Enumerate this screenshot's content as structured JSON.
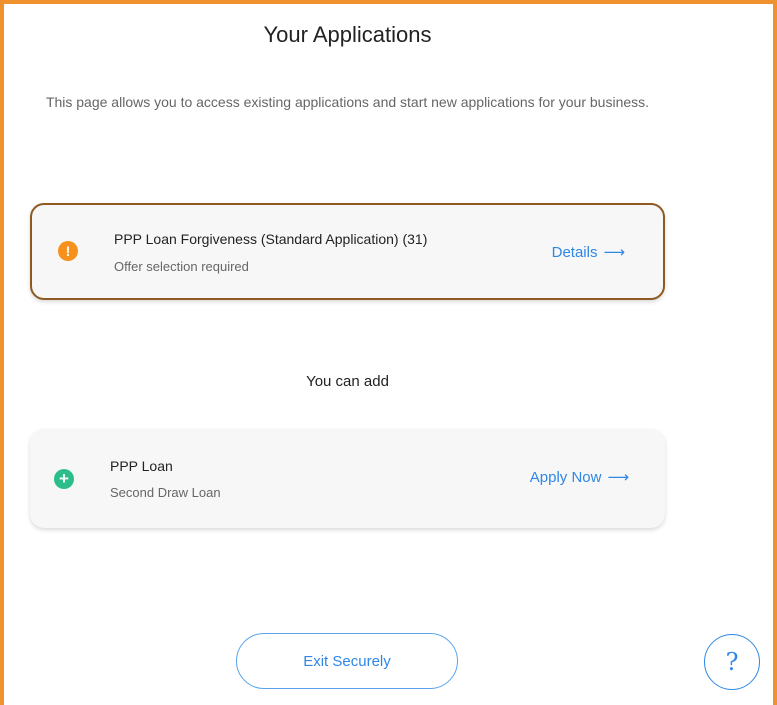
{
  "header": {
    "title": "Your Applications",
    "intro": "This page allows you to access existing applications and start new applications for your business."
  },
  "applications": [
    {
      "title": "PPP Loan Forgiveness (Standard Application) (31)",
      "status": "Offer selection required",
      "status_icon": "exclamation-icon",
      "action_label": "Details",
      "accent_color": "#f7911e"
    }
  ],
  "add_section": {
    "label": "You can add",
    "options": [
      {
        "title": "PPP Loan",
        "subtitle": "Second Draw Loan",
        "icon": "plus-icon",
        "action_label": "Apply Now",
        "accent_color": "#2dbd8a"
      }
    ]
  },
  "footer": {
    "exit_label": "Exit Securely",
    "help_label": "?"
  },
  "colors": {
    "frame": "#f0912f",
    "link": "#2f87e6",
    "card_border": "#8f5a22"
  }
}
